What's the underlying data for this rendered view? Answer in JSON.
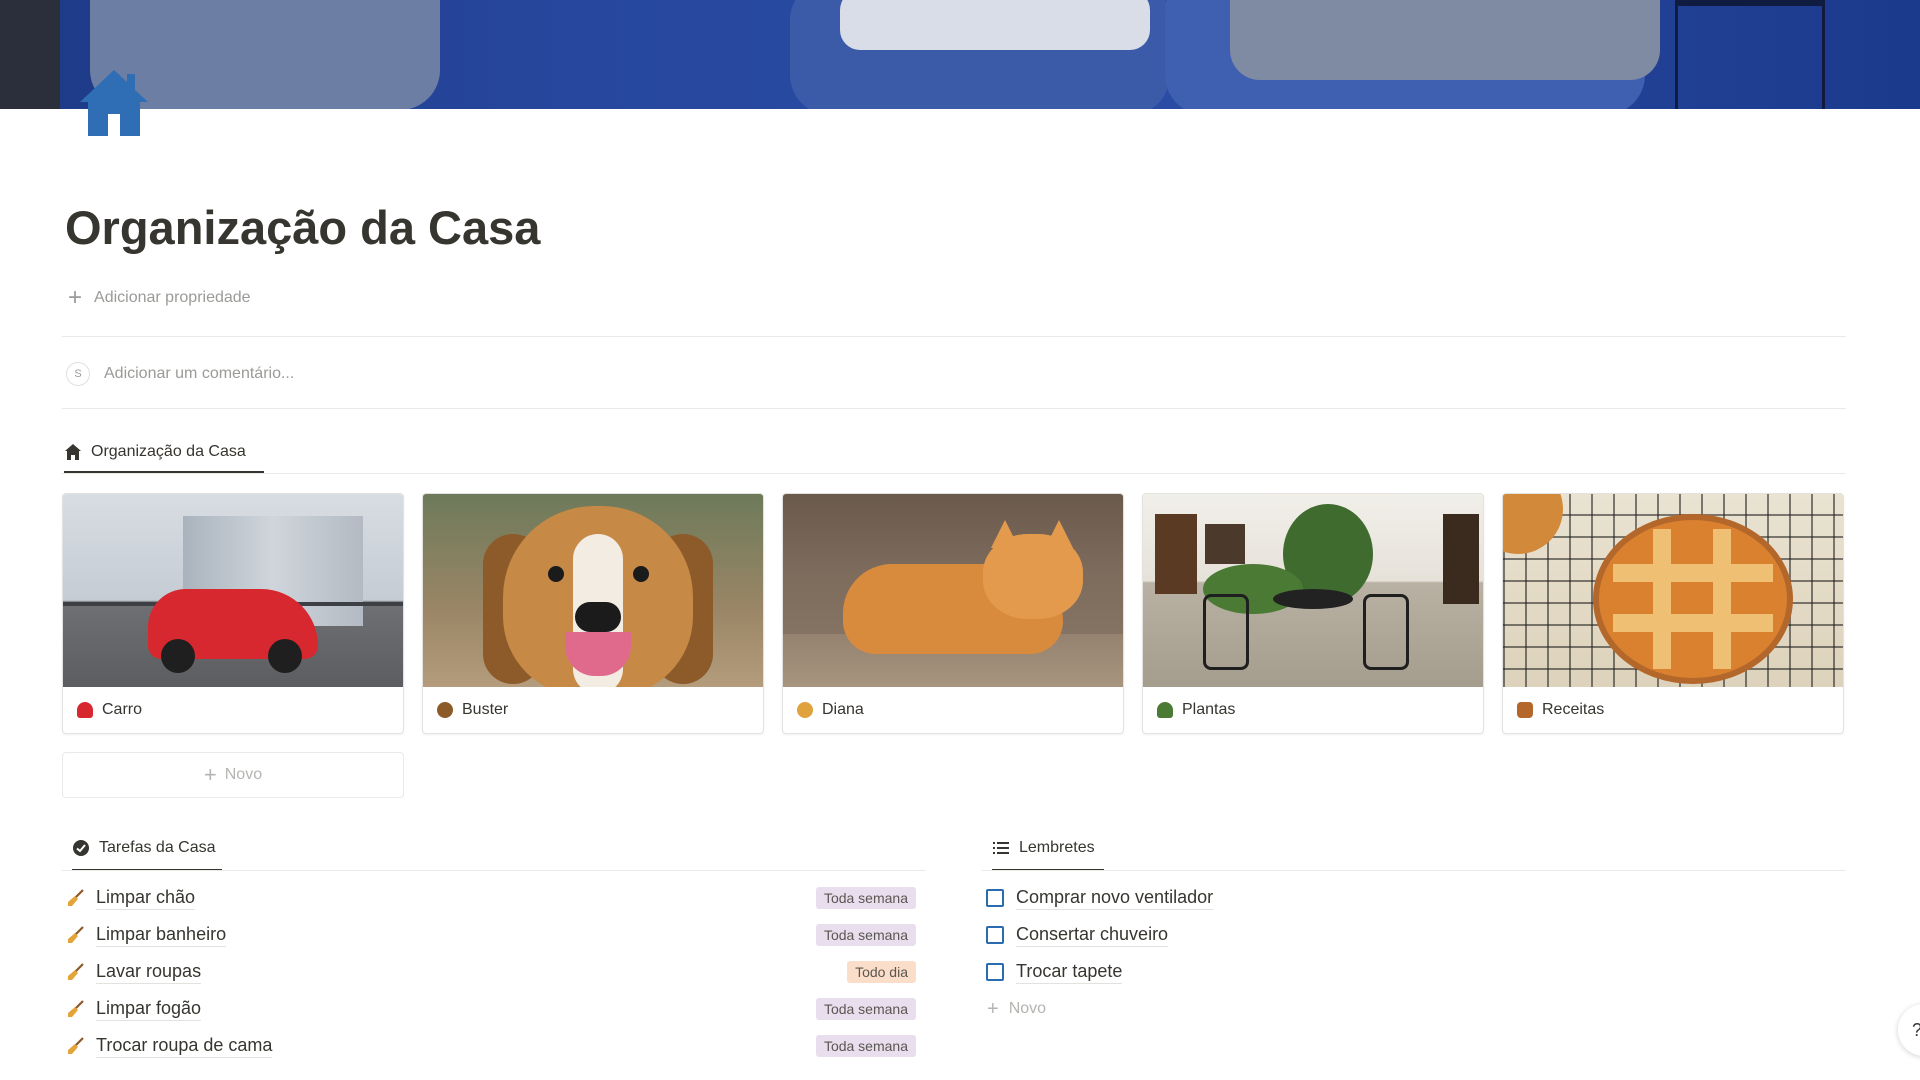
{
  "page": {
    "title": "Organização da Casa",
    "add_property": "Adicionar propriedade",
    "comment_placeholder": "Adicionar um comentário...",
    "comment_avatar": "S",
    "accent": "#2f6db5"
  },
  "gallery": {
    "tab_label": "Organização da Casa",
    "cards": [
      {
        "label": "Carro",
        "emoji_color": "#d7282f"
      },
      {
        "label": "Buster",
        "emoji_color": "#8d5a2a"
      },
      {
        "label": "Diana",
        "emoji_color": "#e0a23c"
      },
      {
        "label": "Plantas",
        "emoji_color": "#4b7a35"
      },
      {
        "label": "Receitas",
        "emoji_color": "#b4672a"
      }
    ],
    "new_label": "Novo"
  },
  "tasks": {
    "tab_label": "Tarefas da Casa",
    "items": [
      {
        "name": "Limpar chão",
        "frequency": "Toda semana"
      },
      {
        "name": "Limpar banheiro",
        "frequency": "Toda semana"
      },
      {
        "name": "Lavar roupas",
        "frequency": "Todo dia"
      },
      {
        "name": "Limpar fogão",
        "frequency": "Toda semana"
      },
      {
        "name": "Trocar roupa de cama",
        "frequency": "Toda semana"
      }
    ],
    "tag_colors": {
      "Toda semana": "#e8deee",
      "Todo dia": "#fadec9"
    }
  },
  "reminders": {
    "tab_label": "Lembretes",
    "items": [
      "Comprar novo ventilador",
      "Consertar chuveiro",
      "Trocar tapete"
    ],
    "new_label": "Novo"
  },
  "help": {
    "label": "?"
  }
}
